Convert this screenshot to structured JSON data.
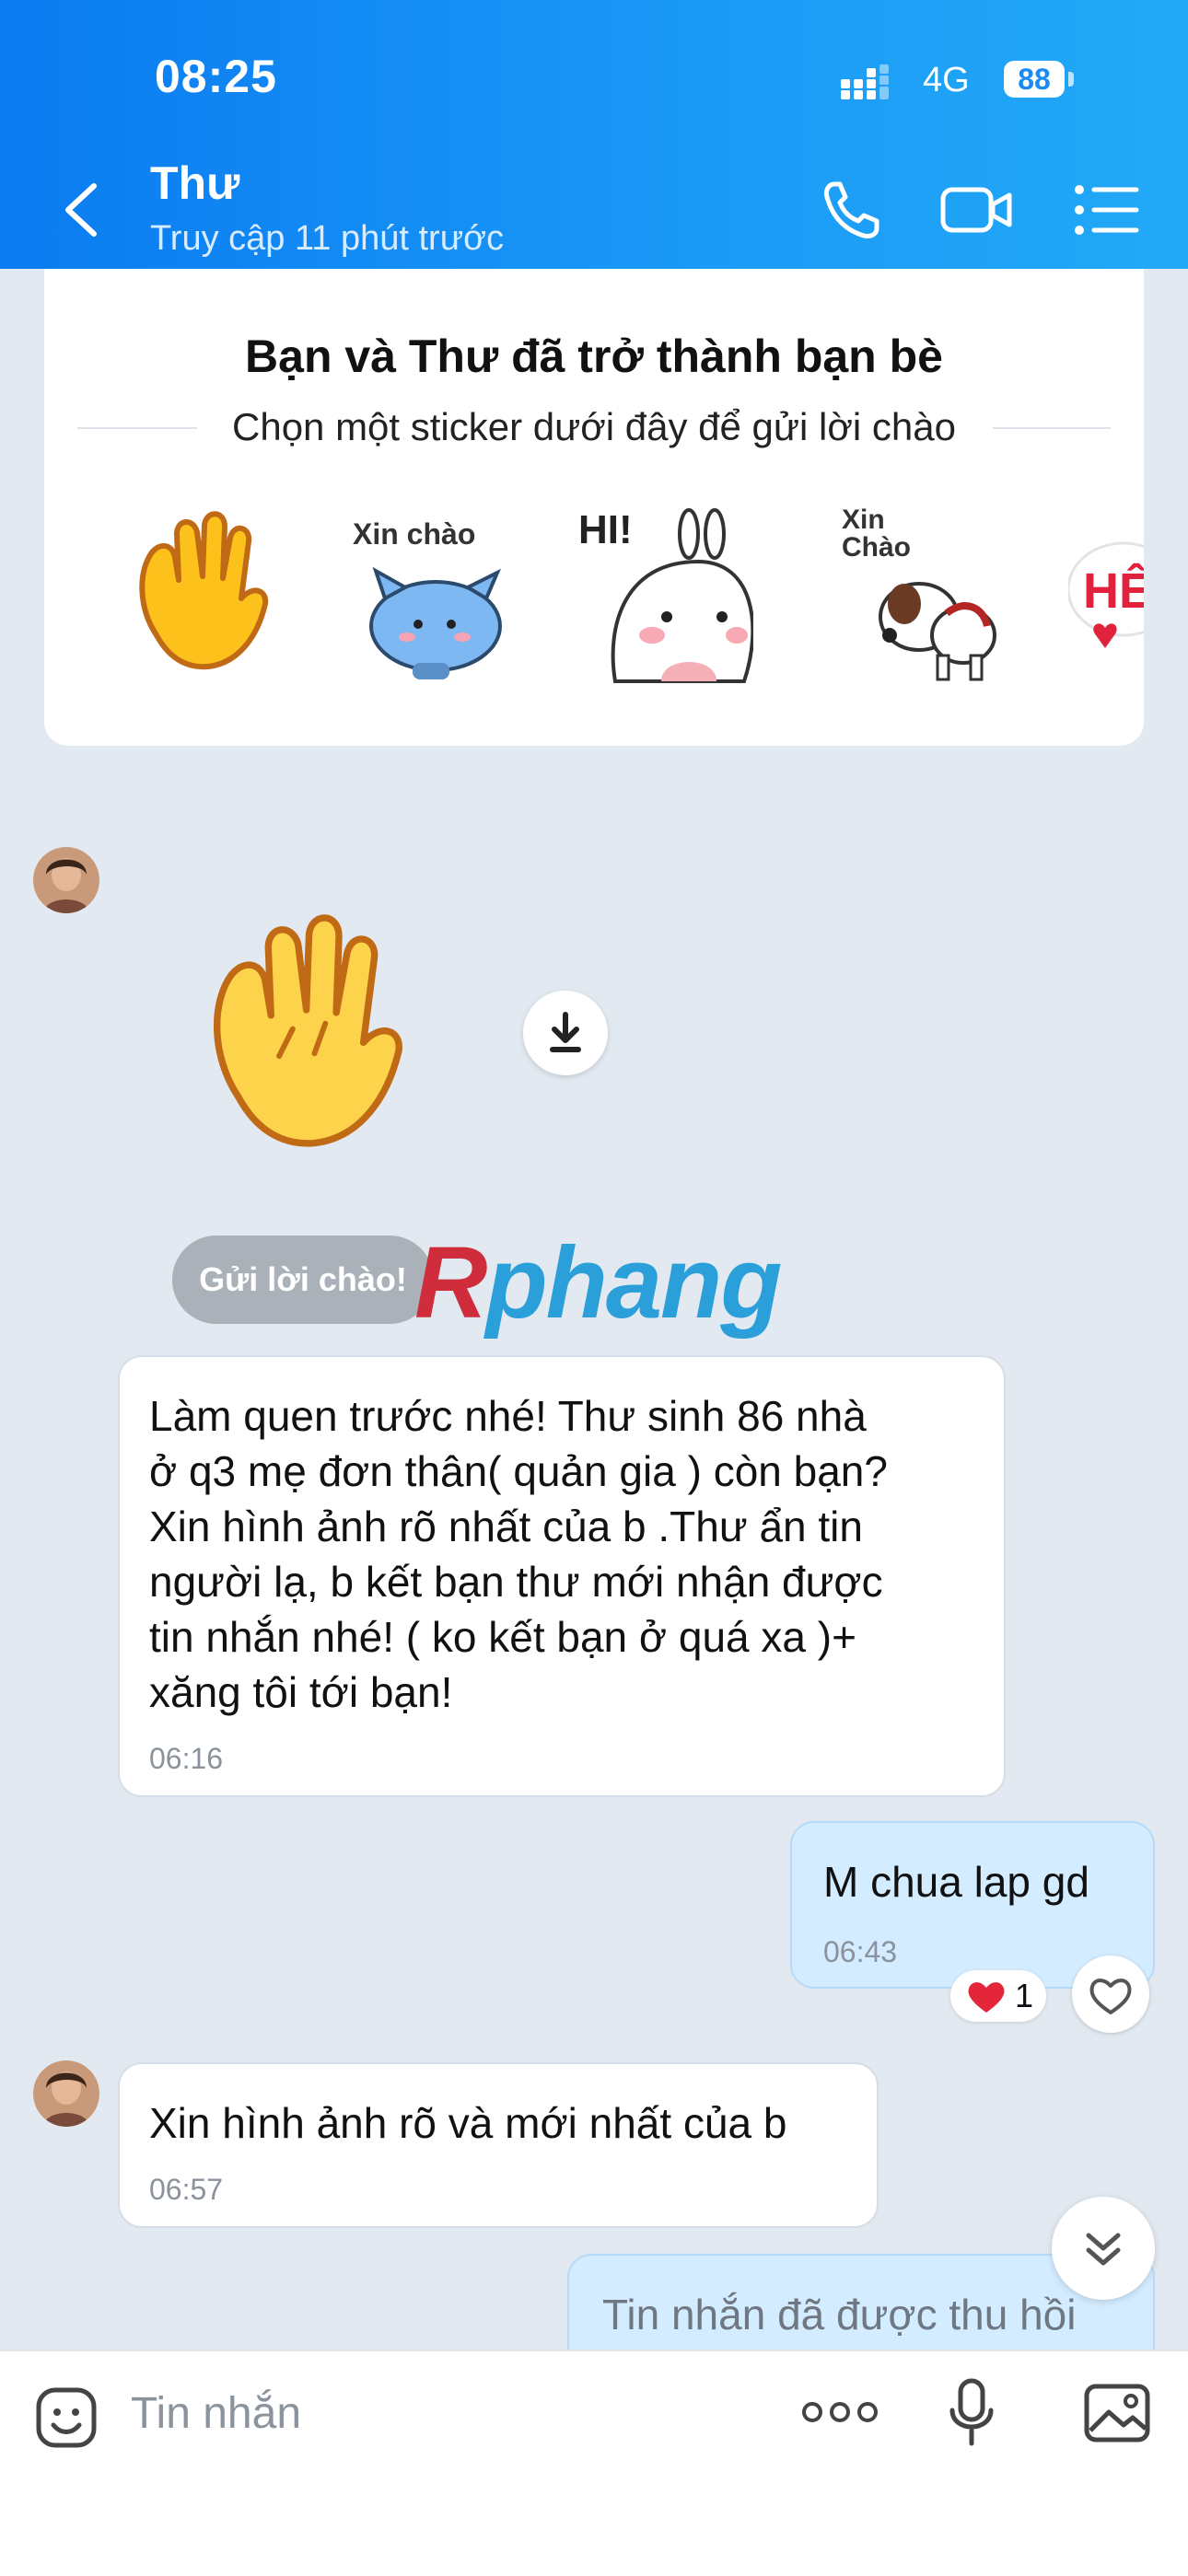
{
  "status_bar": {
    "time": "08:25",
    "network": "4G",
    "battery": "88"
  },
  "header": {
    "name": "Thư",
    "status": "Truy cập 11 phút trước"
  },
  "friend_card": {
    "title": "Bạn và Thư đã trở thành bạn bè",
    "subtitle": "Chọn một sticker dưới đây để gửi lời chào",
    "stickers": [
      {
        "icon": "waving-hand-sticker"
      },
      {
        "icon": "blue-cat-sticker",
        "caption": "Xin chào"
      },
      {
        "icon": "bunny-hi-sticker",
        "caption": "HI!"
      },
      {
        "icon": "dog-sticker",
        "caption": "Xin Chào"
      },
      {
        "icon": "partial-sticker",
        "caption": "HÊ"
      }
    ]
  },
  "messages": [
    {
      "type": "sticker",
      "direction": "incoming",
      "icon": "waving-hand-sticker"
    },
    {
      "direction": "incoming",
      "text": "Làm quen trước nhé!  Thư sinh 86 nhà\nở q3 mẹ đơn thân( quản gia ) còn bạn?\nXin hình ảnh rõ nhất của b .Thư ẩn tin\nngười lạ, b kết bạn thư mới nhận được\ntin nhắn nhé! ( ko kết bạn ở quá xa )+\nxăng tôi tới bạn!",
      "time": "06:16"
    },
    {
      "direction": "outgoing",
      "text": "M chua lap gd",
      "time": "06:43",
      "reaction_count": "1"
    },
    {
      "direction": "incoming",
      "text": "Xin hình ảnh rõ và mới nhất của b",
      "time": "06:57"
    },
    {
      "direction": "outgoing",
      "text": "Tin nhắn đã được thu hồi"
    }
  ],
  "greet_button": "Gửi lời chào!",
  "watermark": {
    "first": "R",
    "rest": "phang"
  },
  "input": {
    "placeholder": "Tin nhắn"
  },
  "colors": {
    "header": "#1b8ff5",
    "chat_bg": "#e2e9f1",
    "outgoing_bubble": "#d4ecff"
  }
}
